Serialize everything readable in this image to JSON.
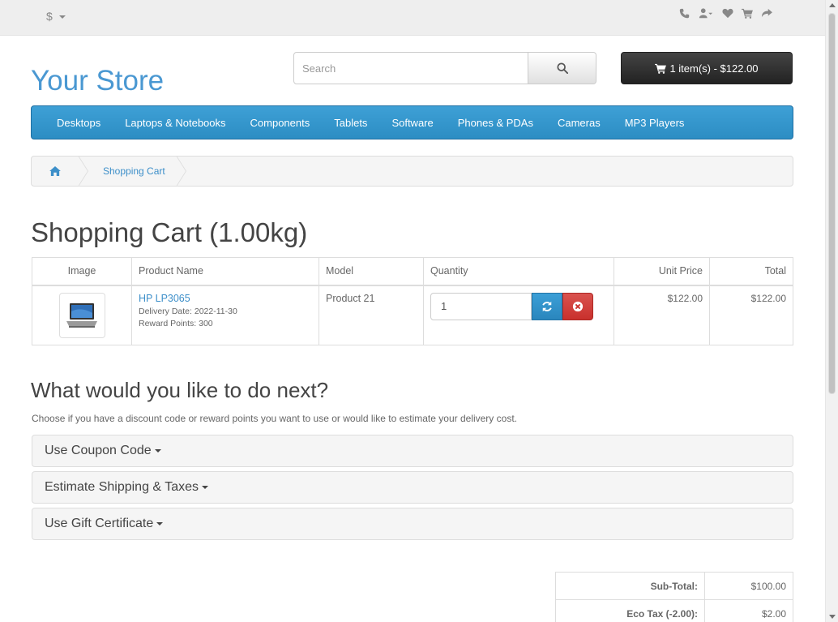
{
  "topbar": {
    "currency": "$",
    "icons": [
      "phone-icon",
      "user-icon",
      "heart-icon",
      "cart-icon",
      "share-icon"
    ]
  },
  "header": {
    "logo": "Your Store",
    "search_placeholder": "Search",
    "cart_button": "1 item(s) - $122.00"
  },
  "menu": {
    "items": [
      "Desktops",
      "Laptops & Notebooks",
      "Components",
      "Tablets",
      "Software",
      "Phones & PDAs",
      "Cameras",
      "MP3 Players"
    ]
  },
  "breadcrumb": {
    "current": "Shopping Cart"
  },
  "page": {
    "title": "Shopping Cart  (1.00kg)"
  },
  "cart": {
    "headers": {
      "image": "Image",
      "name": "Product Name",
      "model": "Model",
      "quantity": "Quantity",
      "unit_price": "Unit Price",
      "total": "Total"
    },
    "items": [
      {
        "name": "HP LP3065",
        "delivery": "Delivery Date: 2022-11-30",
        "reward": "Reward Points: 300",
        "model": "Product 21",
        "quantity": "1",
        "unit_price": "$122.00",
        "total": "$122.00"
      }
    ]
  },
  "next": {
    "heading": "What would you like to do next?",
    "description": "Choose if you have a discount code or reward points you want to use or would like to estimate your delivery cost.",
    "panels": [
      "Use Coupon Code",
      "Estimate Shipping & Taxes",
      "Use Gift Certificate"
    ]
  },
  "totals": [
    {
      "label": "Sub-Total:",
      "value": "$100.00"
    },
    {
      "label": "Eco Tax (-2.00):",
      "value": "$2.00"
    }
  ]
}
